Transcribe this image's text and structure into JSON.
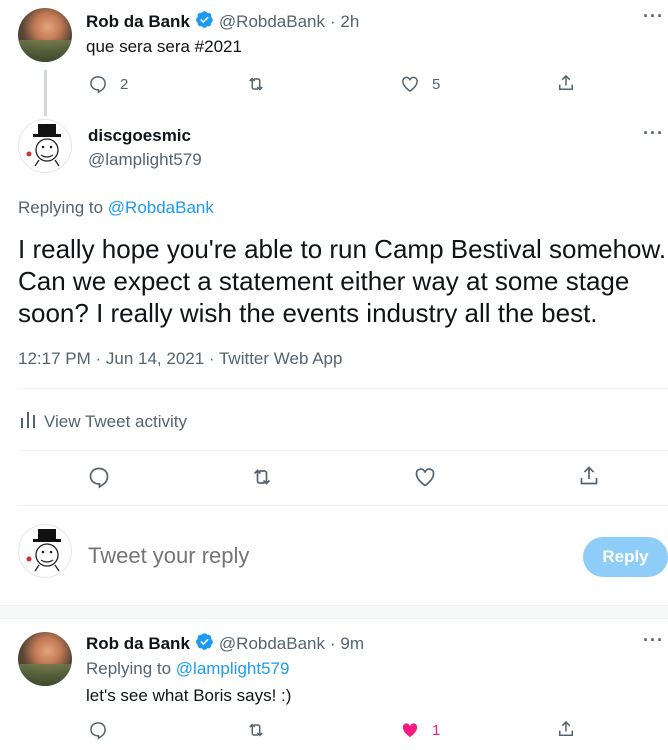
{
  "tweet1": {
    "name": "Rob da Bank",
    "handle": "@RobdaBank",
    "time": "· 2h",
    "text": "que sera sera #2021",
    "reply_count": "2",
    "like_count": "5"
  },
  "main_tweet": {
    "name": "discgoesmic",
    "handle": "@lamplight579",
    "replying_label": "Replying to ",
    "replying_to": "@RobdaBank",
    "text_line1": "I really hope you're able to run Camp Bestival somehow.",
    "text_line2": "Can we expect a statement either way at some stage",
    "text_line3": "soon? I really wish the events industry all the best.",
    "meta": "12:17 PM · Jun 14, 2021 · Twitter Web App",
    "activity_label": "View Tweet activity"
  },
  "composer": {
    "placeholder": "Tweet your reply",
    "button_label": "Reply"
  },
  "tweet3": {
    "name": "Rob da Bank",
    "handle": "@RobdaBank",
    "time": "· 9m",
    "replying_label": "Replying to ",
    "replying_to": "@lamplight579",
    "text": "let's see what Boris says! :)",
    "like_count": "1"
  },
  "colors": {
    "accent": "#1d9bf0",
    "like_red": "#f91880",
    "muted": "#536471"
  },
  "icons": [
    "verified-icon",
    "more-icon",
    "reply-icon",
    "retweet-icon",
    "like-icon",
    "share-icon",
    "activity-icon",
    "heart-filled-icon"
  ]
}
